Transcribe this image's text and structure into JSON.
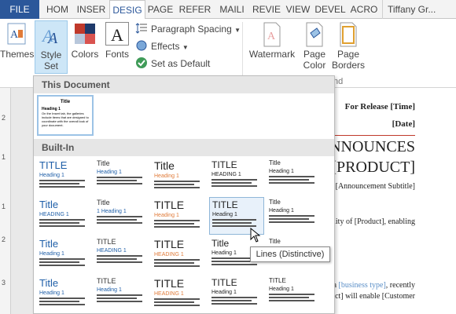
{
  "tabs": {
    "file": "FILE",
    "items": [
      "HOM",
      "INSER",
      "DESIG",
      "PAGE",
      "REFER",
      "MAILI",
      "REVIE",
      "VIEW",
      "DEVEL",
      "ACRO"
    ],
    "active_index": 2,
    "user": "Tiffany Gr..."
  },
  "ribbon": {
    "themes": "Themes",
    "style_set": [
      "Style",
      "Set"
    ],
    "colors": "Colors",
    "fonts": "Fonts",
    "paragraph_spacing": "Paragraph Spacing",
    "effects": "Effects",
    "set_as_default": "Set as Default",
    "watermark": "Watermark",
    "page_color": [
      "Page",
      "Color"
    ],
    "page_borders": [
      "Page",
      "Borders"
    ],
    "group_fragment": "nd"
  },
  "gallery": {
    "this_document": "This Document",
    "built_in": "Built-In",
    "tooltip": "Lines (Distinctive)",
    "current": {
      "title": "Title",
      "heading": "Heading 1",
      "body": "On the Insert tab, the galleries include items that are designed to coordinate with the overall look of your document."
    },
    "thumbs": [
      {
        "title": "TITLE",
        "heading": "Heading 1"
      },
      {
        "title": "Title",
        "heading": "Heading 1"
      },
      {
        "title": "Title",
        "heading": "Heading 1"
      },
      {
        "title": "TITLE",
        "heading": "HEADING 1"
      },
      {
        "title": "Title",
        "heading": "Heading 1"
      },
      {
        "title": "Title",
        "heading": "HEADING 1"
      },
      {
        "title": "Title",
        "heading": "1  Heading 1"
      },
      {
        "title": "TITLE",
        "heading": "Heading 1"
      },
      {
        "title": "TITLE",
        "heading": "Heading 1"
      },
      {
        "title": "Title",
        "heading": "Heading 1"
      },
      {
        "title": "Title",
        "heading": "Heading 1"
      },
      {
        "title": "TITLE",
        "heading": "HEADING 1"
      },
      {
        "title": "TITLE",
        "heading": "HEADING 1"
      },
      {
        "title": "Title",
        "heading": "Heading 1"
      },
      {
        "title": "Title",
        "heading": "Heading 1"
      },
      {
        "title": "Title",
        "heading": "Heading 1"
      },
      {
        "title": "TITLE",
        "heading": "Heading 1"
      },
      {
        "title": "TITLE",
        "heading": "HEADING 1"
      },
      {
        "title": "TITLE",
        "heading": "Heading 1"
      },
      {
        "title": "TITLE",
        "heading": "Heading 1"
      }
    ]
  },
  "document": {
    "for_release": "For Release [Time]",
    "date": "[Date]",
    "announces": "ANNOUNCES",
    "product": "[PRODUCT]",
    "subtitle": "[Announcement Subtitle]",
    "body1": "bility of [Product], enabling",
    "body2a": "a ",
    "business_type": "[business type]",
    "body2b": ", recently",
    "body3": "roduct] will enable [Customer"
  },
  "ruler_numbers": [
    "2",
    "1",
    "1",
    "2",
    "3"
  ],
  "colors": {
    "accent": "#2b579a",
    "ribbon_highlight": "#cde6f7"
  }
}
